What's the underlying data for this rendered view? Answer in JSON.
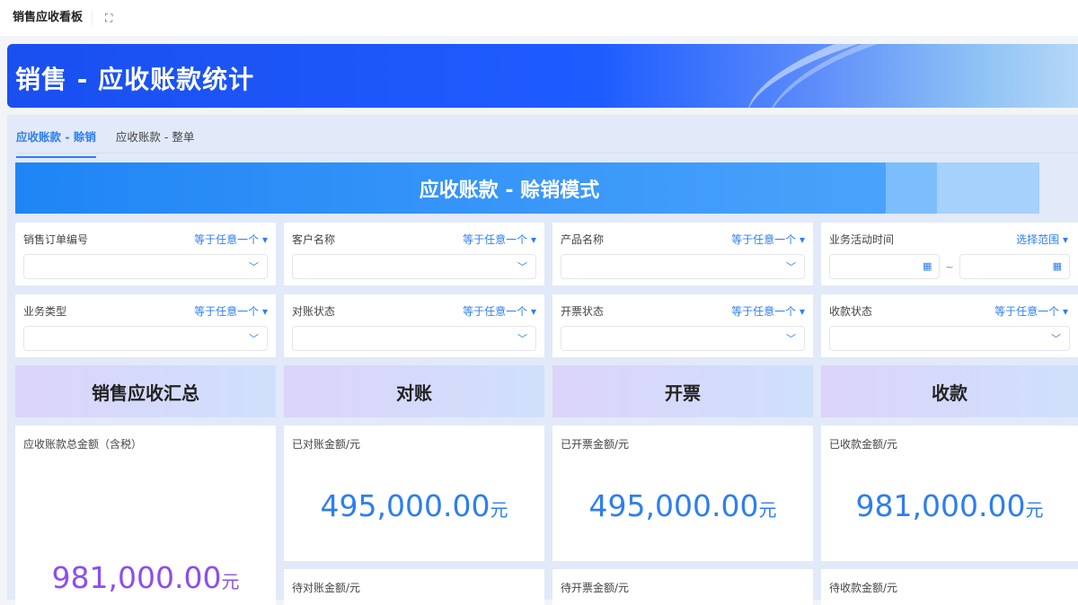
{
  "topbar": {
    "title": "销售应收看板",
    "fullscreen_icon": "expand-icon"
  },
  "banner": {
    "title": "销售 - 应收账款统计"
  },
  "tabs": [
    {
      "label": "应收账款 - 赊销"
    },
    {
      "label": "应收账款 - 整单"
    }
  ],
  "mode_title": "应收账款 - 赊销模式",
  "filters": [
    {
      "label": "销售订单编号",
      "op": "等于任意一个 ▾"
    },
    {
      "label": "客户名称",
      "op": "等于任意一个 ▾"
    },
    {
      "label": "产品名称",
      "op": "等于任意一个 ▾"
    },
    {
      "label": "业务活动时间",
      "op": "选择范围 ▾",
      "range_sep": "~"
    },
    {
      "label": "业务类型",
      "op": "等于任意一个 ▾"
    },
    {
      "label": "对账状态",
      "op": "等于任意一个 ▾"
    },
    {
      "label": "开票状态",
      "op": "等于任意一个 ▾"
    },
    {
      "label": "收款状态",
      "op": "等于任意一个 ▾"
    }
  ],
  "sections": [
    {
      "title": "销售应收汇总"
    },
    {
      "title": "对账"
    },
    {
      "title": "开票"
    },
    {
      "title": "收款"
    }
  ],
  "metrics": {
    "total": {
      "label": "应收账款总金额（含税）",
      "value": "981,000.00",
      "unit": "元"
    },
    "reconciled": {
      "label": "已对账金额/元",
      "value": "495,000.00",
      "unit": "元"
    },
    "invoiced": {
      "label": "已开票金额/元",
      "value": "495,000.00",
      "unit": "元"
    },
    "received": {
      "label": "已收款金额/元",
      "value": "981,000.00",
      "unit": "元"
    },
    "to_reconcile": {
      "label": "待对账金额/元"
    },
    "to_invoice": {
      "label": "待开票金额/元"
    },
    "to_receive": {
      "label": "待收款金额/元"
    }
  },
  "colors": {
    "accent": "#2d7ef0",
    "purple": "#8b4ef0"
  }
}
